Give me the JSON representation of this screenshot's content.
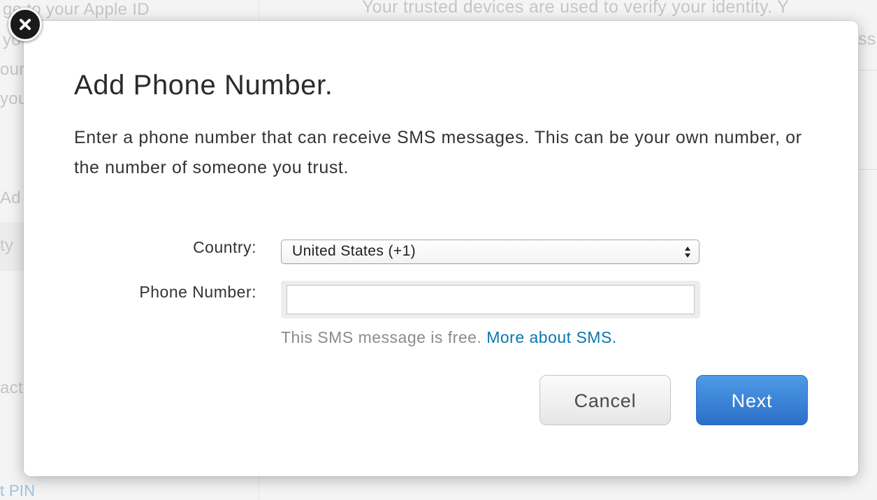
{
  "background": {
    "left_lines": [
      "ge to your Apple ID",
      "yo",
      "our",
      "you"
    ],
    "top_right_line1": "Your trusted devices are used to verify your identity. Y",
    "top_right_line2": "ssa",
    "left_add": "Ad",
    "left_ty": "ty",
    "left_act": "act",
    "left_pin": "t PIN"
  },
  "modal": {
    "title": "Add Phone Number.",
    "description": "Enter a phone number that can receive SMS messages. This can be your own number, or the number of someone you trust.",
    "country_label": "Country:",
    "country_value": "United States (+1)",
    "phone_label": "Phone Number:",
    "phone_value": "",
    "phone_placeholder": "",
    "sms_note": "This SMS message is free.",
    "sms_link": "More about SMS.",
    "cancel_label": "Cancel",
    "next_label": "Next"
  },
  "colors": {
    "next_button": "#3a85d8",
    "link": "#0b75b0",
    "close_button": "#1a1a1a"
  },
  "icons": {
    "close": "close-icon",
    "select_arrows": "select-arrows-icon"
  }
}
